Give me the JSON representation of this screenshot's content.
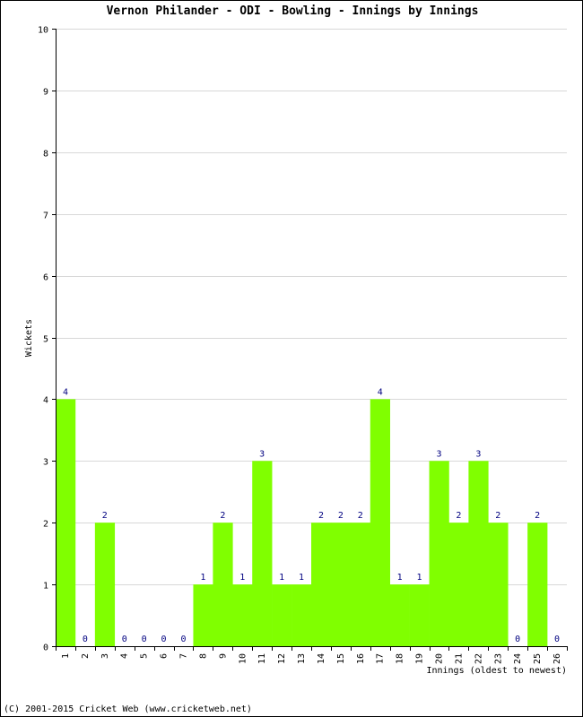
{
  "chart_data": {
    "type": "bar",
    "title": "Vernon Philander - ODI - Bowling - Innings by Innings",
    "xlabel": "Innings (oldest to newest)",
    "ylabel": "Wickets",
    "ylim": [
      0,
      10
    ],
    "yticks": [
      "0",
      "1",
      "2",
      "3",
      "4",
      "5",
      "6",
      "7",
      "8",
      "9",
      "10"
    ],
    "grid": true,
    "categories": [
      "1",
      "2",
      "3",
      "4",
      "5",
      "6",
      "7",
      "8",
      "9",
      "10",
      "11",
      "12",
      "13",
      "14",
      "15",
      "16",
      "17",
      "18",
      "19",
      "20",
      "21",
      "22",
      "23",
      "24",
      "25",
      "26"
    ],
    "values": [
      4,
      0,
      2,
      0,
      0,
      0,
      0,
      1,
      2,
      1,
      3,
      1,
      1,
      2,
      2,
      2,
      4,
      1,
      1,
      3,
      2,
      3,
      2,
      0,
      2,
      0
    ],
    "bar_color": "#80ff00",
    "label_color": "#000080"
  },
  "footer": "(C) 2001-2015 Cricket Web (www.cricketweb.net)"
}
